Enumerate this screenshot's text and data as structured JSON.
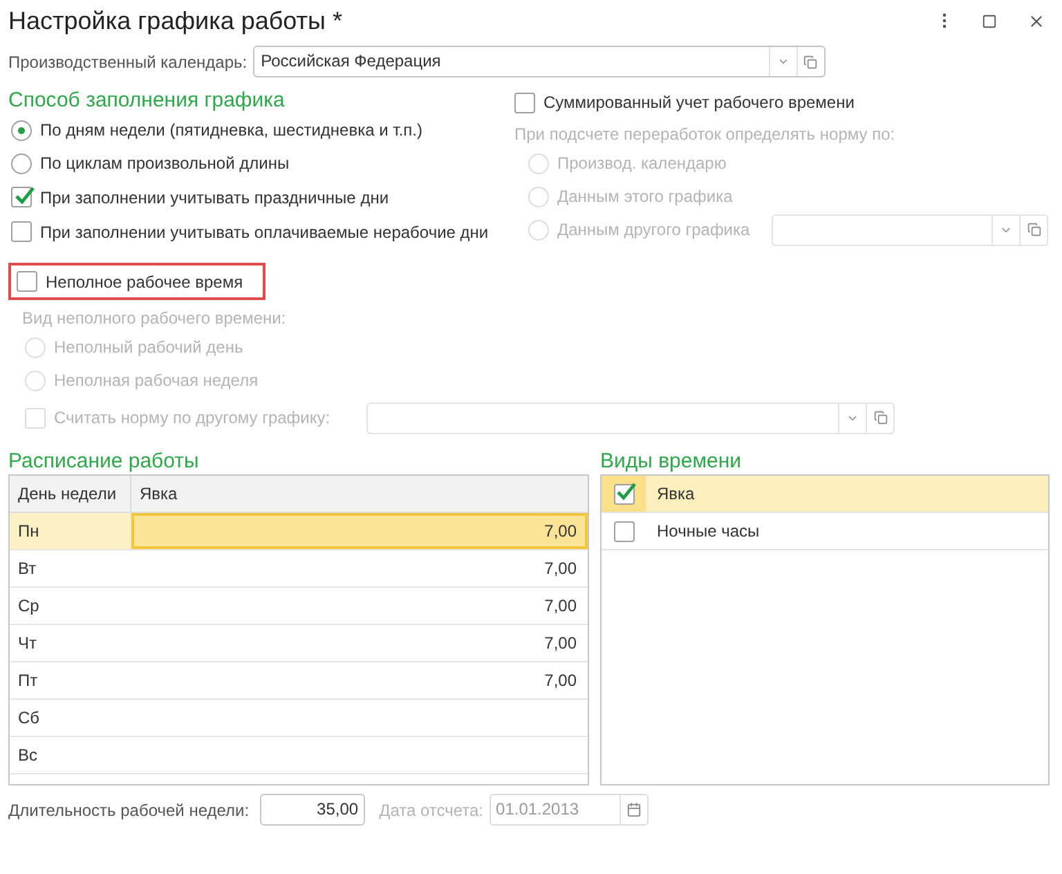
{
  "window": {
    "title": "Настройка графика работы *"
  },
  "calendar": {
    "label": "Производственный календарь:",
    "value": "Российская Федерация"
  },
  "fill_method": {
    "heading": "Способ заполнения графика",
    "options": [
      {
        "label": "По дням недели (пятидневка, шестидневка и т.п.)",
        "selected": true
      },
      {
        "label": "По циклам произвольной длины",
        "selected": false
      }
    ],
    "checkboxes": [
      {
        "label": "При заполнении учитывать праздничные дни",
        "checked": true
      },
      {
        "label": "При заполнении учитывать оплачиваемые нерабочие дни",
        "checked": false
      }
    ]
  },
  "summarized": {
    "label": "Суммированный учет рабочего времени",
    "checked": false,
    "norm_label": "При подсчете переработок определять норму по:",
    "options": [
      {
        "label": "Производ. календарю",
        "selected": false,
        "disabled": true
      },
      {
        "label": "Данным этого графика",
        "selected": false,
        "disabled": true
      },
      {
        "label": "Данным другого графика",
        "selected": false,
        "disabled": true,
        "kind": "with_field"
      }
    ]
  },
  "part_time": {
    "label": "Неполное рабочее время",
    "checked": false,
    "kind_label": "Вид неполного рабочего времени:",
    "options": [
      {
        "label": "Неполный рабочий день",
        "selected": false,
        "disabled": true
      },
      {
        "label": "Неполная рабочая неделя",
        "selected": false,
        "disabled": true
      }
    ],
    "other_norm": {
      "label": "Считать норму по другому графику:",
      "checked": false,
      "disabled": true
    }
  },
  "schedule": {
    "heading": "Расписание работы",
    "columns": [
      "День недели",
      "Явка"
    ],
    "rows": [
      {
        "day": "Пн",
        "value": "7,00",
        "selected": true
      },
      {
        "day": "Вт",
        "value": "7,00",
        "selected": false
      },
      {
        "day": "Ср",
        "value": "7,00",
        "selected": false
      },
      {
        "day": "Чт",
        "value": "7,00",
        "selected": false
      },
      {
        "day": "Пт",
        "value": "7,00",
        "selected": false
      },
      {
        "day": "Сб",
        "selected": false
      },
      {
        "day": "Вс",
        "selected": false
      }
    ]
  },
  "time_kinds": {
    "heading": "Виды времени",
    "items": [
      {
        "label": "Явка",
        "checked": true,
        "selected": true
      },
      {
        "label": "Ночные часы",
        "checked": false,
        "selected": false
      }
    ]
  },
  "footer": {
    "week_label": "Длительность рабочей недели:",
    "week_value": "35,00",
    "date_label": "Дата отсчета:",
    "date_value": "01.01.2013"
  }
}
